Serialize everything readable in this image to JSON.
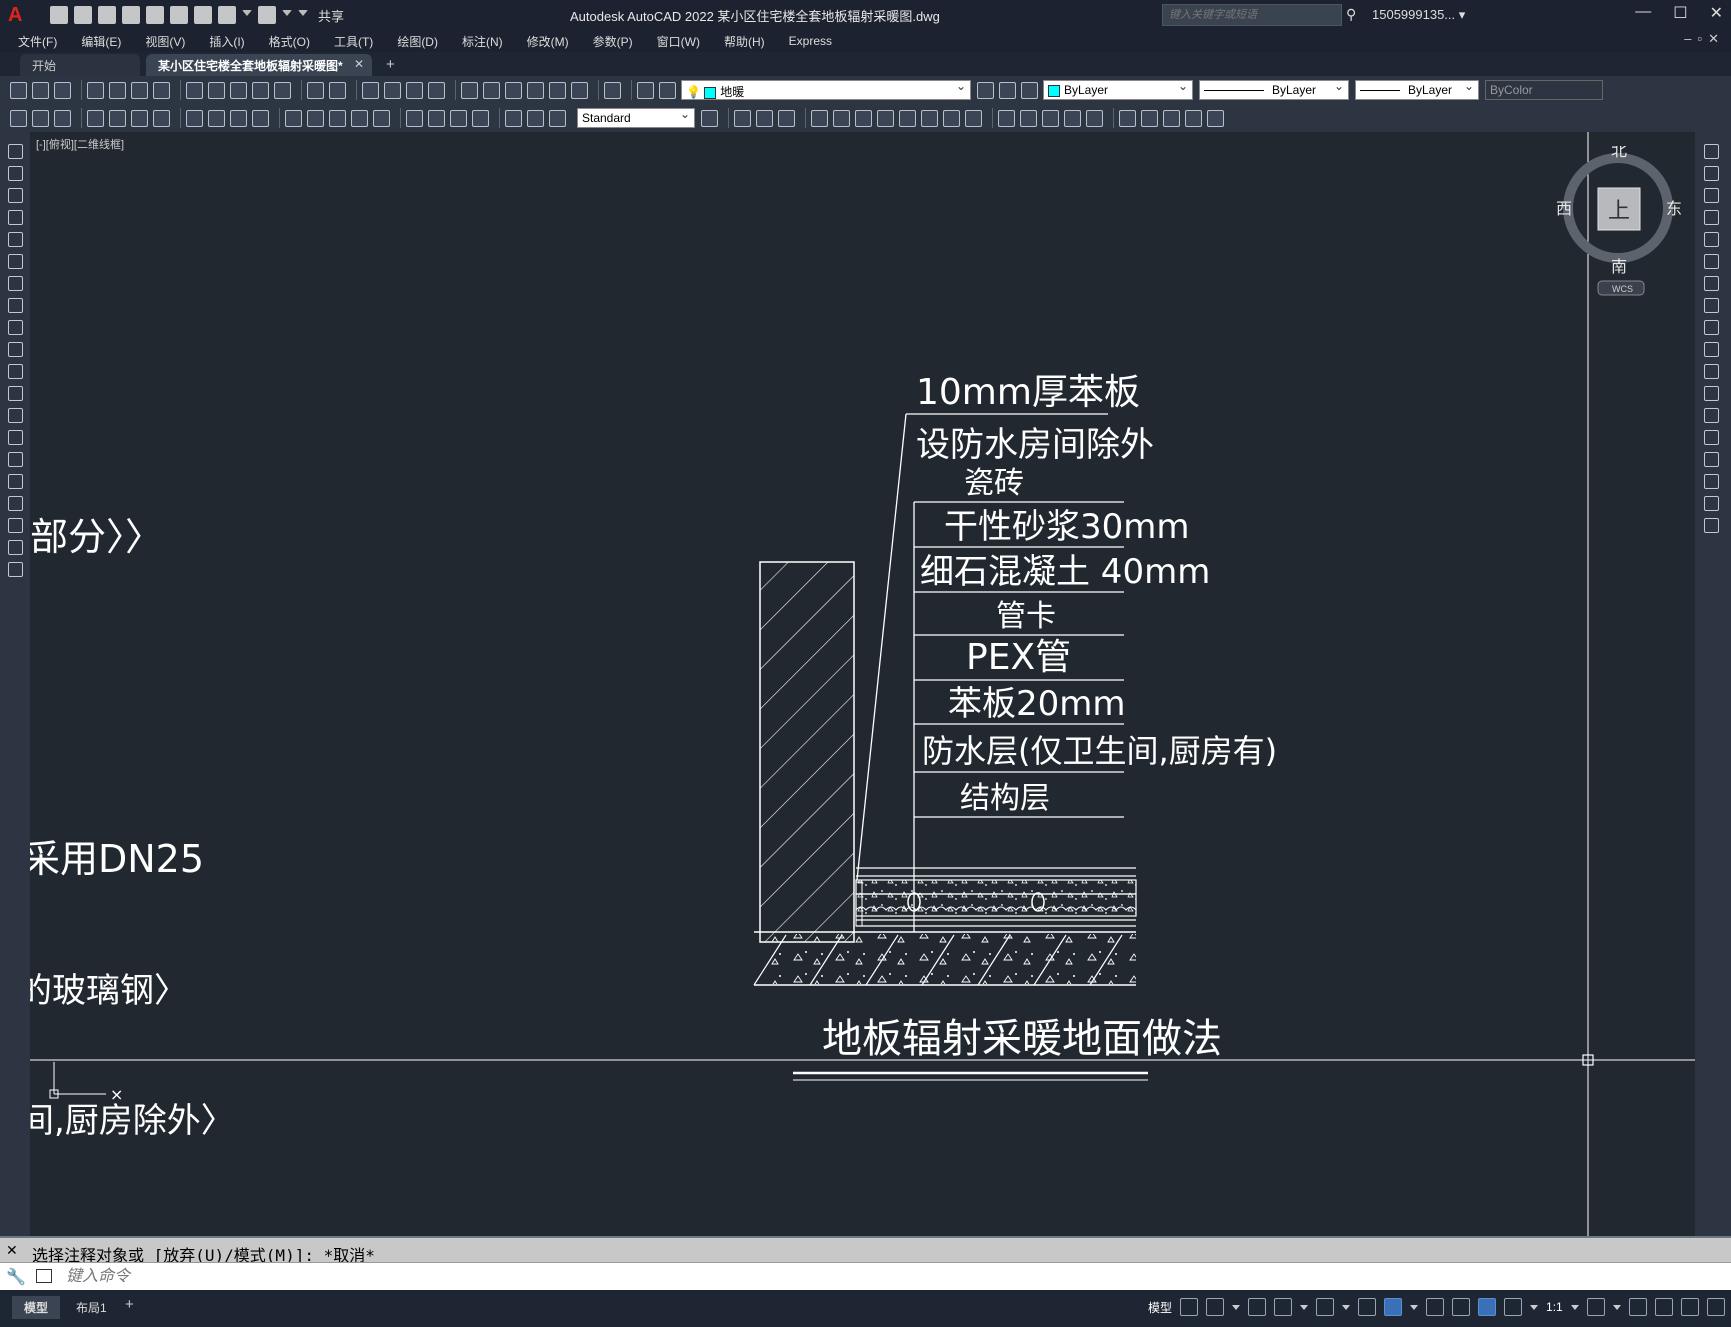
{
  "app": {
    "title": "Autodesk AutoCAD 2022    某小区住宅楼全套地板辐射采暖图.dwg",
    "share_label": "共享",
    "search_placeholder": "键入关键字或短语",
    "user": "1505999135... ▾"
  },
  "menu": [
    "文件(F)",
    "编辑(E)",
    "视图(V)",
    "插入(I)",
    "格式(O)",
    "工具(T)",
    "绘图(D)",
    "标注(N)",
    "修改(M)",
    "参数(P)",
    "窗口(W)",
    "帮助(H)",
    "Express"
  ],
  "tabs": {
    "start": "开始",
    "active": "某小区住宅楼全套地板辐射采暖图*",
    "close": "✕",
    "add": "+"
  },
  "toolbar": {
    "layer": "地暖",
    "color": "ByLayer",
    "linetype": "ByLayer",
    "lineweight": "ByLayer",
    "plotstyle": "ByColor",
    "textstyle": "Standard",
    "layer_color": "#00ffff"
  },
  "viewport": {
    "label": "[-][俯视][二维线框]",
    "compass": {
      "n": "北",
      "s": "南",
      "e": "东",
      "w": "西",
      "top": "上",
      "wcs": "WCS"
    }
  },
  "drawing": {
    "left_fragments": [
      "部分〉〉",
      "采用DN25",
      "的玻璃钢〉",
      "间,厨房除外〉"
    ],
    "layer_labels": [
      "10mm厚苯板",
      "设防水房间除外",
      "瓷砖",
      "干性砂浆30mm",
      "细石混凝土  40mm",
      "管卡",
      "PEX管",
      "苯板20mm",
      "防水层(仅卫生间,厨房有)",
      "结构层"
    ],
    "title": "地板辐射采暖地面做法"
  },
  "command": {
    "history": "选择注释对象或 [放弃(U)/模式(M)]: *取消*",
    "placeholder": "键入命令"
  },
  "status": {
    "model_tab": "模型",
    "layout_tab": "布局1",
    "add": "+",
    "model_label": "模型",
    "scale": "1:1"
  }
}
